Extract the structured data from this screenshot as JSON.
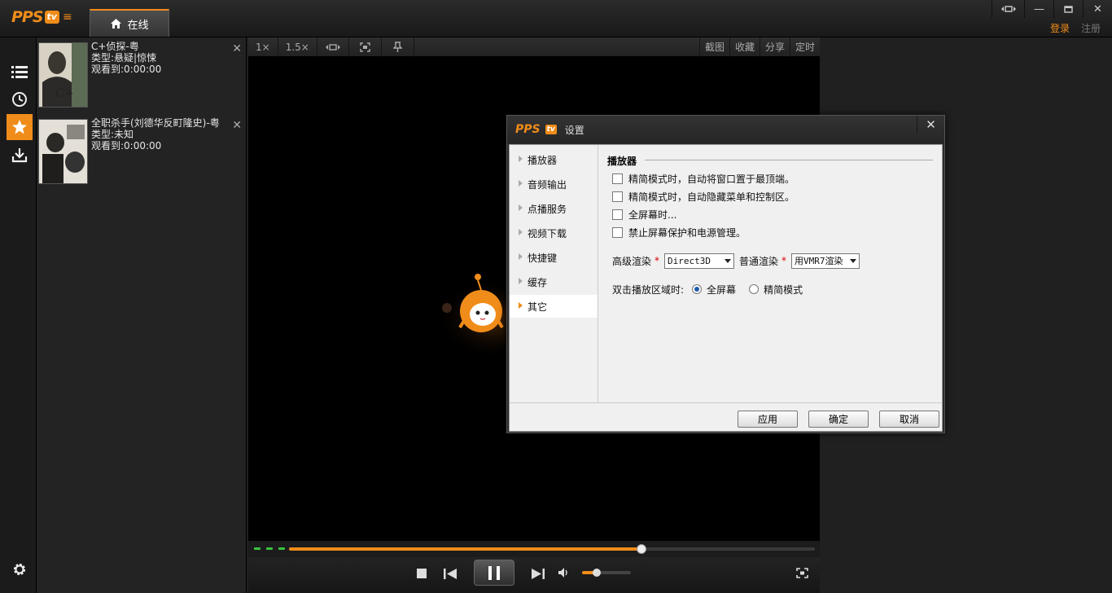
{
  "header": {
    "logo_text": "PPS",
    "logo_badge": "tv",
    "tab_online_label": "在线",
    "login_label": "登录",
    "register_label": "注册"
  },
  "history": {
    "items": [
      {
        "title": "C+侦探-粤",
        "genre": "类型:悬疑|惊悚",
        "progress": "观看到:0:00:00"
      },
      {
        "title": "全职杀手(刘德华反町隆史)-粤",
        "genre": "类型:未知",
        "progress": "观看到:0:00:00"
      }
    ]
  },
  "player_toolbar": {
    "speed_1x": "1×",
    "speed_15x": "1.5×",
    "screenshot": "截图",
    "favorite": "收藏",
    "share": "分享",
    "timer": "定时"
  },
  "playback": {
    "progress_fraction": 0.67,
    "volume_fraction": 0.3
  },
  "dialog": {
    "title": "设置",
    "nav": [
      "播放器",
      "音频输出",
      "点播服务",
      "视频下载",
      "快捷键",
      "缓存",
      "其它"
    ],
    "active_nav_index": 6,
    "section_title": "播放器",
    "checkboxes": [
      "精简模式时，自动将窗口置于最顶端。",
      "精简模式时，自动隐藏菜单和控制区。",
      "全屏幕时...",
      "禁止屏幕保护和电源管理。"
    ],
    "advanced_render_label": "高级渲染",
    "advanced_render_value": "Direct3D",
    "normal_render_label": "普通渲染",
    "normal_render_value": "用VMR7渲染",
    "required_mark": "*",
    "dblclick_label": "双击播放区域时:",
    "radio_fullscreen": "全屏幕",
    "radio_simple": "精简模式",
    "btn_apply": "应用",
    "btn_ok": "确定",
    "btn_cancel": "取消"
  },
  "colors": {
    "accent": "#f08c1a",
    "progress_dots": "#39c43f"
  }
}
